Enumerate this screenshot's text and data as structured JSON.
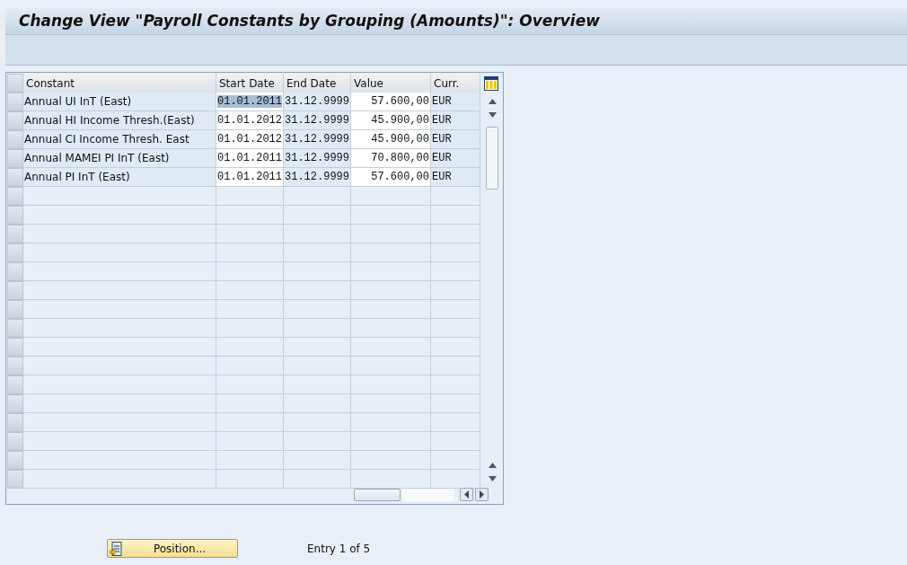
{
  "window": {
    "title": "Change View \"Payroll Constants by Grouping (Amounts)\": Overview"
  },
  "table": {
    "columns": [
      "Constant",
      "Start Date",
      "End Date",
      "Value",
      "Curr."
    ],
    "rows": [
      {
        "constant": "Annual UI InT (East)",
        "start_date": "01.01.2011",
        "end_date": "31.12.9999",
        "value": "57.600,00",
        "currency": "EUR",
        "focused": true
      },
      {
        "constant": "Annual HI Income Thresh.(East)",
        "start_date": "01.01.2012",
        "end_date": "31.12.9999",
        "value": "45.900,00",
        "currency": "EUR",
        "focused": false
      },
      {
        "constant": "Annual CI Income Thresh. East",
        "start_date": "01.01.2012",
        "end_date": "31.12.9999",
        "value": "45.900,00",
        "currency": "EUR",
        "focused": false
      },
      {
        "constant": "Annual MAMEI PI InT (East)",
        "start_date": "01.01.2011",
        "end_date": "31.12.9999",
        "value": "70.800,00",
        "currency": "EUR",
        "focused": false
      },
      {
        "constant": "Annual PI InT (East)",
        "start_date": "01.01.2011",
        "end_date": "31.12.9999",
        "value": "57.600,00",
        "currency": "EUR",
        "focused": false
      }
    ]
  },
  "footer": {
    "position_button": "Position...",
    "entry_info": "Entry 1 of 5"
  }
}
